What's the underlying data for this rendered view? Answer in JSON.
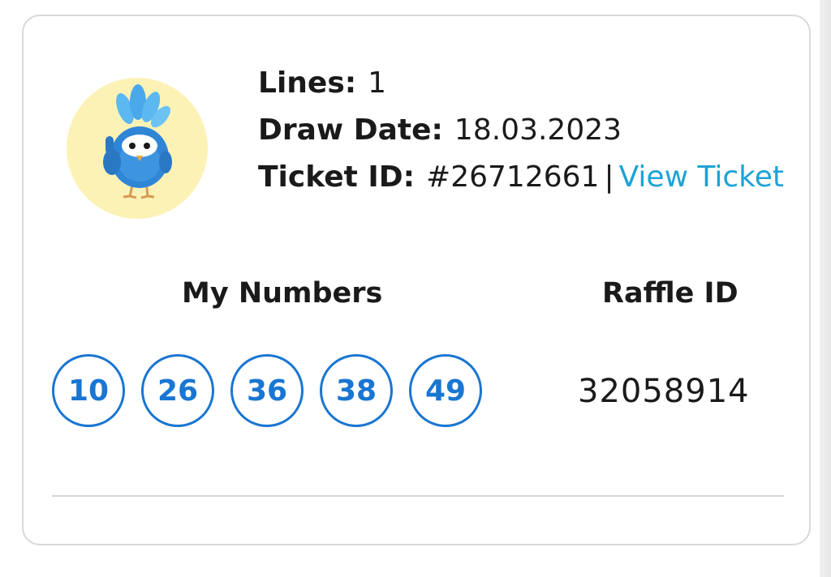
{
  "ticket": {
    "lines_label": "Lines:",
    "lines_value": "1",
    "draw_date_label": "Draw Date:",
    "draw_date_value": "18.03.2023",
    "ticket_id_label": "Ticket ID:",
    "ticket_id_value": "#26712661",
    "separator": "|",
    "view_ticket_label": "View Ticket"
  },
  "numbers": {
    "title": "My Numbers",
    "balls": [
      "10",
      "26",
      "36",
      "38",
      "49"
    ]
  },
  "raffle": {
    "title": "Raffle ID",
    "value": "32058914"
  },
  "colors": {
    "ball_blue": "#1976d2",
    "link_blue": "#1ea3d6",
    "avatar_bg": "#fdf2b6",
    "mascot_blue": "#2f86d6"
  },
  "icons": {
    "avatar": "mascot-bird-thumbs-up-icon"
  }
}
